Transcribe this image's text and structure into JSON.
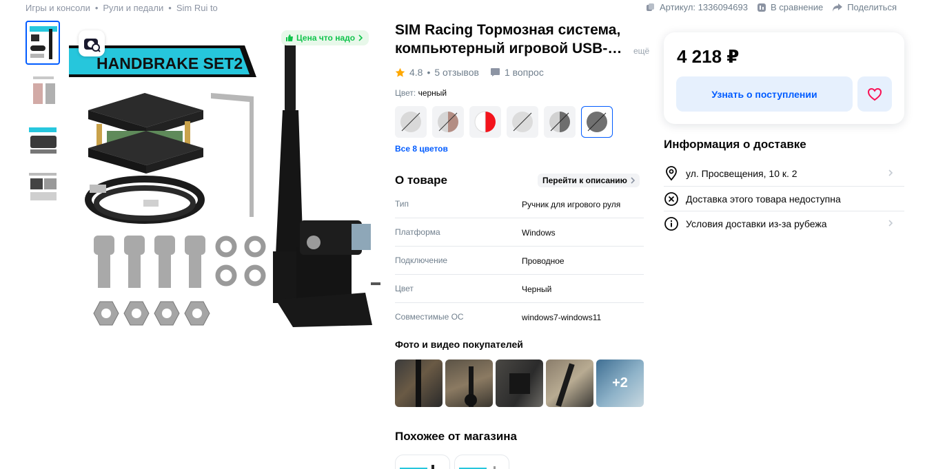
{
  "breadcrumbs": [
    "Игры и консоли",
    "Рули и педали",
    "Sim Rui to"
  ],
  "topbar": {
    "article": "Артикул: 1336094693",
    "compare": "В сравнение",
    "share": "Поделиться"
  },
  "gallery": {
    "price_badge": "Цена что надо",
    "banner_text": "HANDBRAKE SET2"
  },
  "product": {
    "title": "SIM Racing Тормозная система, компьютерный игровой USB-…",
    "title_more": "ещё",
    "rating": "4.8",
    "reviews": "5 отзывов",
    "questions": "1 вопрос",
    "color_label": "Цвет:",
    "color_value": "черный",
    "all_colors": "Все 8 цветов"
  },
  "about": {
    "heading": "О товаре",
    "to_description": "Перейти к описанию",
    "specs": [
      {
        "key": "Тип",
        "value": "Ручник для игрового руля"
      },
      {
        "key": "Платформа",
        "value": "Windows"
      },
      {
        "key": "Подключение",
        "value": "Проводное"
      },
      {
        "key": "Цвет",
        "value": "Черный"
      },
      {
        "key": "Совместимые ОС",
        "value": "windows7-windows11"
      }
    ]
  },
  "photos": {
    "heading": "Фото и видео покупателей",
    "more": "+2"
  },
  "similar": {
    "heading": "Похожее от магазина"
  },
  "buy": {
    "price": "4 218 ₽",
    "notify": "Узнать о поступлении"
  },
  "delivery": {
    "heading": "Информация о доставке",
    "address": "ул. Просвещения, 10 к. 2",
    "unavailable": "Доставка этого товара недоступна",
    "abroad": "Условия доставки из-за рубежа"
  },
  "colors": {
    "accent": "#005bff",
    "green": "#10c44c",
    "muted": "#707f8d",
    "heart": "#f91155"
  }
}
